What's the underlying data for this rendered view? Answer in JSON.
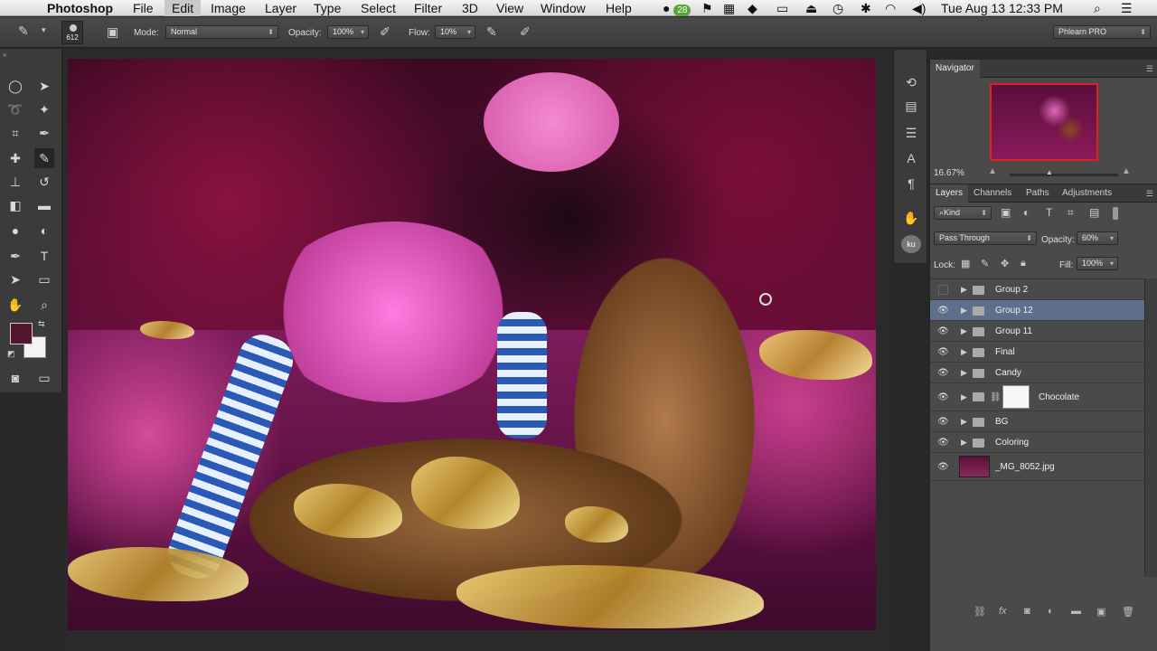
{
  "menubar": {
    "app": "Photoshop",
    "items": [
      "File",
      "Edit",
      "Image",
      "Layer",
      "Type",
      "Select",
      "Filter",
      "3D",
      "View",
      "Window",
      "Help"
    ],
    "badge": "28",
    "datetime": "Tue Aug 13  12:33 PM"
  },
  "options": {
    "brush_size": "612",
    "mode_label": "Mode:",
    "mode_value": "Normal",
    "opacity_label": "Opacity:",
    "opacity_value": "100%",
    "flow_label": "Flow:",
    "flow_value": "10%",
    "workspace": "Phlearn PRO"
  },
  "colors": {
    "foreground": "#54162e",
    "background": "#f3f3f3",
    "selection": "#5d6f8a"
  },
  "navigator": {
    "tab": "Navigator",
    "zoom": "16.67%"
  },
  "layers_panel": {
    "tabs": [
      "Layers",
      "Channels",
      "Paths",
      "Adjustments"
    ],
    "filter_label": "Kind",
    "blend_mode": "Pass Through",
    "opacity_label": "Opacity:",
    "opacity_value": "60%",
    "lock_label": "Lock:",
    "fill_label": "Fill:",
    "fill_value": "100%",
    "layers": [
      {
        "name": "Group 2",
        "visible": false,
        "selected": false,
        "type": "group"
      },
      {
        "name": "Group 12",
        "visible": true,
        "selected": true,
        "type": "group"
      },
      {
        "name": "Group 11",
        "visible": true,
        "selected": false,
        "type": "group"
      },
      {
        "name": "Final",
        "visible": true,
        "selected": false,
        "type": "group"
      },
      {
        "name": "Candy",
        "visible": true,
        "selected": false,
        "type": "group"
      },
      {
        "name": "Chocolate",
        "visible": true,
        "selected": false,
        "type": "group-mask"
      },
      {
        "name": "BG",
        "visible": true,
        "selected": false,
        "type": "group"
      },
      {
        "name": "Coloring",
        "visible": true,
        "selected": false,
        "type": "group"
      },
      {
        "name": "_MG_8052.jpg",
        "visible": true,
        "selected": false,
        "type": "image"
      }
    ]
  }
}
